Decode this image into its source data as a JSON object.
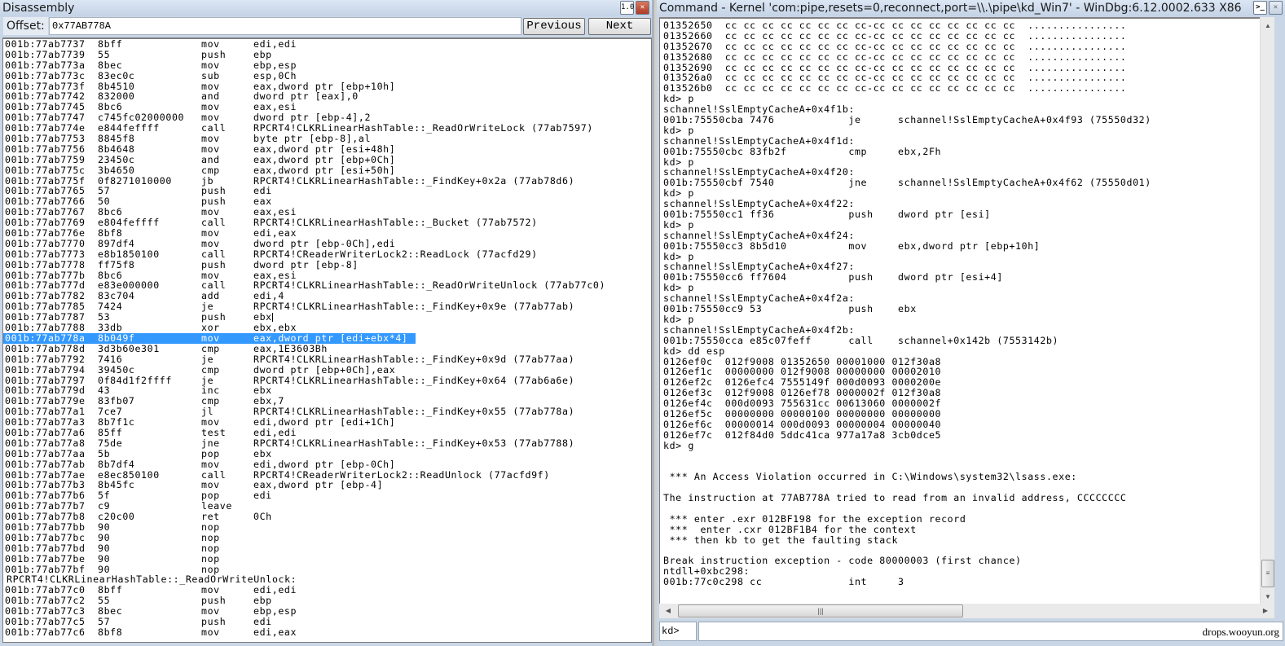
{
  "disassembly": {
    "title": "Disassembly",
    "offset_label": "Offset:",
    "offset_value": "0x77AB778A",
    "previous_label": "Previous",
    "next_label": "Next",
    "icons": {
      "float": "window-float-icon",
      "close": "close-icon"
    },
    "selected_address": "001b:77ab778a",
    "lines": [
      {
        "addr": "001b:77ab7737",
        "bytes": "8bff",
        "mn": "mov",
        "op": "edi,edi"
      },
      {
        "addr": "001b:77ab7739",
        "bytes": "55",
        "mn": "push",
        "op": "ebp"
      },
      {
        "addr": "001b:77ab773a",
        "bytes": "8bec",
        "mn": "mov",
        "op": "ebp,esp"
      },
      {
        "addr": "001b:77ab773c",
        "bytes": "83ec0c",
        "mn": "sub",
        "op": "esp,0Ch"
      },
      {
        "addr": "001b:77ab773f",
        "bytes": "8b4510",
        "mn": "mov",
        "op": "eax,dword ptr [ebp+10h]"
      },
      {
        "addr": "001b:77ab7742",
        "bytes": "832000",
        "mn": "and",
        "op": "dword ptr [eax],0"
      },
      {
        "addr": "001b:77ab7745",
        "bytes": "8bc6",
        "mn": "mov",
        "op": "eax,esi"
      },
      {
        "addr": "001b:77ab7747",
        "bytes": "c745fc02000000",
        "mn": "mov",
        "op": "dword ptr [ebp-4],2"
      },
      {
        "addr": "001b:77ab774e",
        "bytes": "e844feffff",
        "mn": "call",
        "op": "RPCRT4!CLKRLinearHashTable::_ReadOrWriteLock (77ab7597)"
      },
      {
        "addr": "001b:77ab7753",
        "bytes": "8845f8",
        "mn": "mov",
        "op": "byte ptr [ebp-8],al"
      },
      {
        "addr": "001b:77ab7756",
        "bytes": "8b4648",
        "mn": "mov",
        "op": "eax,dword ptr [esi+48h]"
      },
      {
        "addr": "001b:77ab7759",
        "bytes": "23450c",
        "mn": "and",
        "op": "eax,dword ptr [ebp+0Ch]"
      },
      {
        "addr": "001b:77ab775c",
        "bytes": "3b4650",
        "mn": "cmp",
        "op": "eax,dword ptr [esi+50h]"
      },
      {
        "addr": "001b:77ab775f",
        "bytes": "0f8271010000",
        "mn": "jb",
        "op": "RPCRT4!CLKRLinearHashTable::_FindKey+0x2a (77ab78d6)"
      },
      {
        "addr": "001b:77ab7765",
        "bytes": "57",
        "mn": "push",
        "op": "edi"
      },
      {
        "addr": "001b:77ab7766",
        "bytes": "50",
        "mn": "push",
        "op": "eax"
      },
      {
        "addr": "001b:77ab7767",
        "bytes": "8bc6",
        "mn": "mov",
        "op": "eax,esi"
      },
      {
        "addr": "001b:77ab7769",
        "bytes": "e804feffff",
        "mn": "call",
        "op": "RPCRT4!CLKRLinearHashTable::_Bucket (77ab7572)"
      },
      {
        "addr": "001b:77ab776e",
        "bytes": "8bf8",
        "mn": "mov",
        "op": "edi,eax"
      },
      {
        "addr": "001b:77ab7770",
        "bytes": "897df4",
        "mn": "mov",
        "op": "dword ptr [ebp-0Ch],edi"
      },
      {
        "addr": "001b:77ab7773",
        "bytes": "e8b1850100",
        "mn": "call",
        "op": "RPCRT4!CReaderWriterLock2::ReadLock (77acfd29)"
      },
      {
        "addr": "001b:77ab7778",
        "bytes": "ff75f8",
        "mn": "push",
        "op": "dword ptr [ebp-8]"
      },
      {
        "addr": "001b:77ab777b",
        "bytes": "8bc6",
        "mn": "mov",
        "op": "eax,esi"
      },
      {
        "addr": "001b:77ab777d",
        "bytes": "e83e000000",
        "mn": "call",
        "op": "RPCRT4!CLKRLinearHashTable::_ReadOrWriteUnlock (77ab77c0)"
      },
      {
        "addr": "001b:77ab7782",
        "bytes": "83c704",
        "mn": "add",
        "op": "edi,4"
      },
      {
        "addr": "001b:77ab7785",
        "bytes": "7424",
        "mn": "je",
        "op": "RPCRT4!CLKRLinearHashTable::_FindKey+0x9e (77ab77ab)"
      },
      {
        "addr": "001b:77ab7787",
        "bytes": "53",
        "mn": "push",
        "op": "ebx",
        "caret": true
      },
      {
        "addr": "001b:77ab7788",
        "bytes": "33db",
        "mn": "xor",
        "op": "ebx,ebx"
      },
      {
        "addr": "001b:77ab778a",
        "bytes": "8b049f",
        "mn": "mov",
        "op": "eax,dword ptr [edi+ebx*4]",
        "selected": true
      },
      {
        "addr": "001b:77ab778d",
        "bytes": "3d3b60e301",
        "mn": "cmp",
        "op": "eax,1E3603Bh"
      },
      {
        "addr": "001b:77ab7792",
        "bytes": "7416",
        "mn": "je",
        "op": "RPCRT4!CLKRLinearHashTable::_FindKey+0x9d (77ab77aa)"
      },
      {
        "addr": "001b:77ab7794",
        "bytes": "39450c",
        "mn": "cmp",
        "op": "dword ptr [ebp+0Ch],eax"
      },
      {
        "addr": "001b:77ab7797",
        "bytes": "0f84d1f2ffff",
        "mn": "je",
        "op": "RPCRT4!CLKRLinearHashTable::_FindKey+0x64 (77ab6a6e)"
      },
      {
        "addr": "001b:77ab779d",
        "bytes": "43",
        "mn": "inc",
        "op": "ebx"
      },
      {
        "addr": "001b:77ab779e",
        "bytes": "83fb07",
        "mn": "cmp",
        "op": "ebx,7"
      },
      {
        "addr": "001b:77ab77a1",
        "bytes": "7ce7",
        "mn": "jl",
        "op": "RPCRT4!CLKRLinearHashTable::_FindKey+0x55 (77ab778a)"
      },
      {
        "addr": "001b:77ab77a3",
        "bytes": "8b7f1c",
        "mn": "mov",
        "op": "edi,dword ptr [edi+1Ch]"
      },
      {
        "addr": "001b:77ab77a6",
        "bytes": "85ff",
        "mn": "test",
        "op": "edi,edi"
      },
      {
        "addr": "001b:77ab77a8",
        "bytes": "75de",
        "mn": "jne",
        "op": "RPCRT4!CLKRLinearHashTable::_FindKey+0x53 (77ab7788)"
      },
      {
        "addr": "001b:77ab77aa",
        "bytes": "5b",
        "mn": "pop",
        "op": "ebx"
      },
      {
        "addr": "001b:77ab77ab",
        "bytes": "8b7df4",
        "mn": "mov",
        "op": "edi,dword ptr [ebp-0Ch]"
      },
      {
        "addr": "001b:77ab77ae",
        "bytes": "e8ec850100",
        "mn": "call",
        "op": "RPCRT4!CReaderWriterLock2::ReadUnlock (77acfd9f)"
      },
      {
        "addr": "001b:77ab77b3",
        "bytes": "8b45fc",
        "mn": "mov",
        "op": "eax,dword ptr [ebp-4]"
      },
      {
        "addr": "001b:77ab77b6",
        "bytes": "5f",
        "mn": "pop",
        "op": "edi"
      },
      {
        "addr": "001b:77ab77b7",
        "bytes": "c9",
        "mn": "leave",
        "op": ""
      },
      {
        "addr": "001b:77ab77b8",
        "bytes": "c20c00",
        "mn": "ret",
        "op": "0Ch"
      },
      {
        "addr": "001b:77ab77bb",
        "bytes": "90",
        "mn": "nop",
        "op": ""
      },
      {
        "addr": "001b:77ab77bc",
        "bytes": "90",
        "mn": "nop",
        "op": ""
      },
      {
        "addr": "001b:77ab77bd",
        "bytes": "90",
        "mn": "nop",
        "op": ""
      },
      {
        "addr": "001b:77ab77be",
        "bytes": "90",
        "mn": "nop",
        "op": ""
      },
      {
        "addr": "001b:77ab77bf",
        "bytes": "90",
        "mn": "nop",
        "op": ""
      },
      {
        "label": "RPCRT4!CLKRLinearHashTable::_ReadOrWriteUnlock:"
      },
      {
        "addr": "001b:77ab77c0",
        "bytes": "8bff",
        "mn": "mov",
        "op": "edi,edi"
      },
      {
        "addr": "001b:77ab77c2",
        "bytes": "55",
        "mn": "push",
        "op": "ebp"
      },
      {
        "addr": "001b:77ab77c3",
        "bytes": "8bec",
        "mn": "mov",
        "op": "ebp,esp"
      },
      {
        "addr": "001b:77ab77c5",
        "bytes": "57",
        "mn": "push",
        "op": "edi"
      },
      {
        "addr": "001b:77ab77c6",
        "bytes": "8bf8",
        "mn": "mov",
        "op": "edi,eax"
      }
    ]
  },
  "command": {
    "title": "Command - Kernel 'com:pipe,resets=0,reconnect,port=\\\\.\\pipe\\kd_Win7' - WinDbg:6.12.0002.633 X86",
    "icons": {
      "cmd": "command-prompt-icon",
      "close": "close-icon"
    },
    "prompt_label": "kd>",
    "input_value": "",
    "watermark": "drops.wooyun.org",
    "output_lines": [
      "01352650  cc cc cc cc cc cc cc cc-cc cc cc cc cc cc cc cc  ................",
      "01352660  cc cc cc cc cc cc cc cc-cc cc cc cc cc cc cc cc  ................",
      "01352670  cc cc cc cc cc cc cc cc-cc cc cc cc cc cc cc cc  ................",
      "01352680  cc cc cc cc cc cc cc cc-cc cc cc cc cc cc cc cc  ................",
      "01352690  cc cc cc cc cc cc cc cc-cc cc cc cc cc cc cc cc  ................",
      "013526a0  cc cc cc cc cc cc cc cc-cc cc cc cc cc cc cc cc  ................",
      "013526b0  cc cc cc cc cc cc cc cc-cc cc cc cc cc cc cc cc  ................",
      "kd> p",
      "schannel!SslEmptyCacheA+0x4f1b:",
      "001b:75550cba 7476            je      schannel!SslEmptyCacheA+0x4f93 (75550d32)",
      "kd> p",
      "schannel!SslEmptyCacheA+0x4f1d:",
      "001b:75550cbc 83fb2f          cmp     ebx,2Fh",
      "kd> p",
      "schannel!SslEmptyCacheA+0x4f20:",
      "001b:75550cbf 7540            jne     schannel!SslEmptyCacheA+0x4f62 (75550d01)",
      "kd> p",
      "schannel!SslEmptyCacheA+0x4f22:",
      "001b:75550cc1 ff36            push    dword ptr [esi]",
      "kd> p",
      "schannel!SslEmptyCacheA+0x4f24:",
      "001b:75550cc3 8b5d10          mov     ebx,dword ptr [ebp+10h]",
      "kd> p",
      "schannel!SslEmptyCacheA+0x4f27:",
      "001b:75550cc6 ff7604          push    dword ptr [esi+4]",
      "kd> p",
      "schannel!SslEmptyCacheA+0x4f2a:",
      "001b:75550cc9 53              push    ebx",
      "kd> p",
      "schannel!SslEmptyCacheA+0x4f2b:",
      "001b:75550cca e85c07feff      call    schannel+0x142b (7553142b)",
      "kd> dd esp",
      "0126ef0c  012f9008 01352650 00001000 012f30a8",
      "0126ef1c  00000000 012f9008 00000000 00002010",
      "0126ef2c  0126efc4 7555149f 000d0093 0000200e",
      "0126ef3c  012f9008 0126ef78 0000002f 012f30a8",
      "0126ef4c  000d0093 755631cc 00613060 0000002f",
      "0126ef5c  00000000 00000100 00000000 00000000",
      "0126ef6c  00000014 000d0093 00000004 00000040",
      "0126ef7c  012f84d0 5ddc41ca 977a17a8 3cb0dce5",
      "kd> g",
      "",
      "",
      " *** An Access Violation occurred in C:\\Windows\\system32\\lsass.exe:",
      "",
      "The instruction at 77AB778A tried to read from an invalid address, CCCCCCCC",
      "",
      " *** enter .exr 012BF198 for the exception record",
      " ***  enter .cxr 012BF1B4 for the context",
      " *** then kb to get the faulting stack",
      "",
      "Break instruction exception - code 80000003 (first chance)",
      "ntdll+0xbc298:",
      "001b:77c0c298 cc              int     3"
    ]
  }
}
